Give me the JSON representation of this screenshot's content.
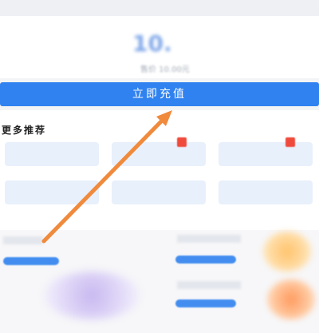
{
  "header": {
    "title": ""
  },
  "amount_card": {
    "label": "",
    "right_label": "",
    "amount": "10.",
    "price": "售价 10.00元"
  },
  "recharge_button": {
    "label": "立即充值"
  },
  "recommend": {
    "title": "更多推荐",
    "tiles": [
      {
        "label": ""
      },
      {
        "label": ""
      },
      {
        "label": ""
      },
      {
        "label": ""
      },
      {
        "label": ""
      },
      {
        "label": ""
      }
    ],
    "badges": [
      {
        "label": ""
      },
      {
        "label": ""
      }
    ]
  },
  "colors": {
    "accent": "#2f82ef",
    "badge": "#ef4b3d",
    "arrow": "#f08a3c"
  },
  "watermark": ""
}
